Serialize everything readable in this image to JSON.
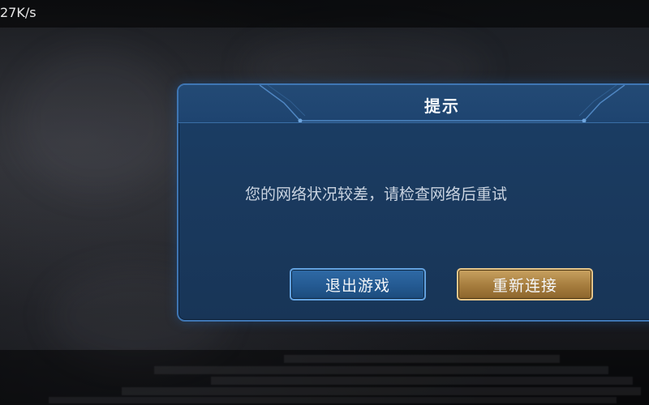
{
  "status_bar": {
    "net_speed": "27K/s"
  },
  "dialog": {
    "title": "提示",
    "message": "您的网络状况较差，请检查网络后重试",
    "buttons": {
      "exit": "退出游戏",
      "reconnect": "重新连接"
    }
  },
  "colors": {
    "dialog_border": "#3f76b3",
    "dialog_bg": "#1a3a5f",
    "exit_button": "#245a92",
    "reconnect_button": "#a57c3d"
  }
}
